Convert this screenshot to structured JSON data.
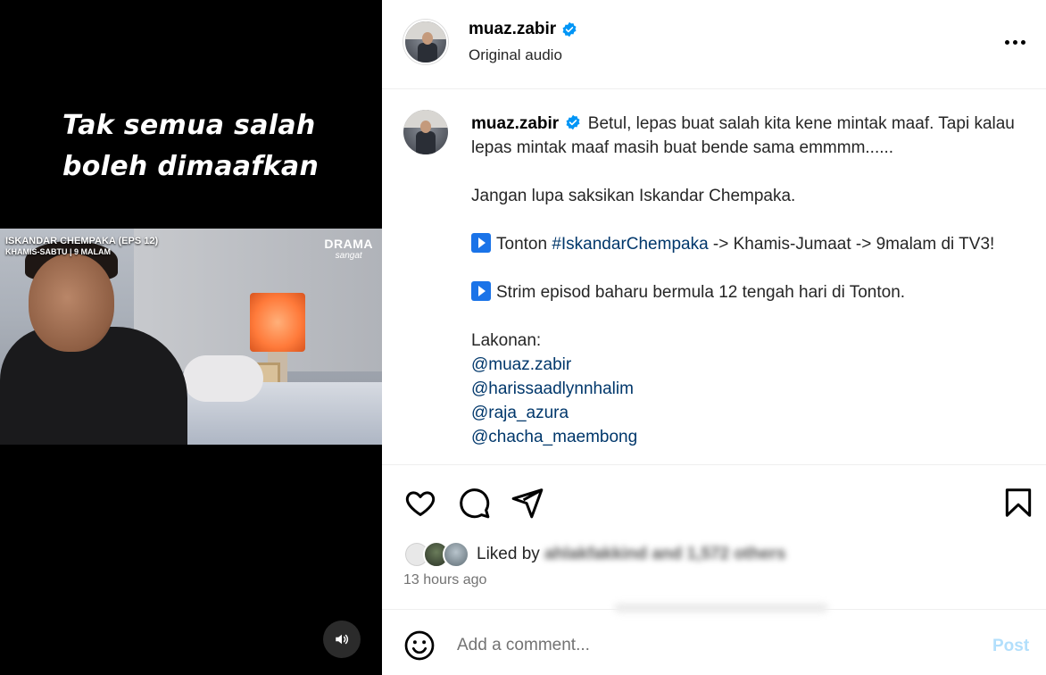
{
  "video": {
    "overlay_caption": "Tak semua salah boleh dimaafkan",
    "show_title": "ISKANDAR CHEMPAKA (EPS 12)",
    "show_schedule": "KHAMIS-SABTU | 9 MALAM",
    "logo_line1": "DRAMA",
    "logo_line2": "sangat",
    "mute_icon": "speaker-icon"
  },
  "header": {
    "username": "muaz.zabir",
    "audio": "Original audio",
    "verified_icon": "verified-badge-icon",
    "more_icon": "more-options-icon"
  },
  "caption": {
    "username": "muaz.zabir",
    "line1": "Betul, lepas buat salah kita kene mintak maaf. Tapi kalau lepas mintak maaf masih buat bende sama emmmm......",
    "line2": "Jangan lupa saksikan Iskandar Chempaka.",
    "tonton_prefix": "Tonton ",
    "tonton_hashtag": "#IskandarChempaka",
    "tonton_suffix": " -> Khamis-Jumaat -> 9malam di TV3!",
    "strim": "Strim episod baharu bermula 12 tengah hari di Tonton.",
    "lakonan": "Lakonan:",
    "mentions": [
      "@muaz.zabir",
      "@harissaadlynnhalim",
      "@raja_azura",
      "@chacha_maembong"
    ]
  },
  "actions": {
    "like_icon": "heart-icon",
    "comment_icon": "comment-icon",
    "share_icon": "share-icon",
    "save_icon": "bookmark-icon"
  },
  "likes": {
    "prefix": "Liked by",
    "blurred_text": "ahlakfakkind and 1,572 others"
  },
  "timestamp": "13 hours ago",
  "comment": {
    "placeholder": "Add a comment...",
    "post_label": "Post",
    "emoji_icon": "emoji-icon"
  },
  "colors": {
    "link": "#00376b",
    "verified": "#0095f6",
    "post_disabled": "#b2dffc",
    "muted_text": "#737373"
  }
}
